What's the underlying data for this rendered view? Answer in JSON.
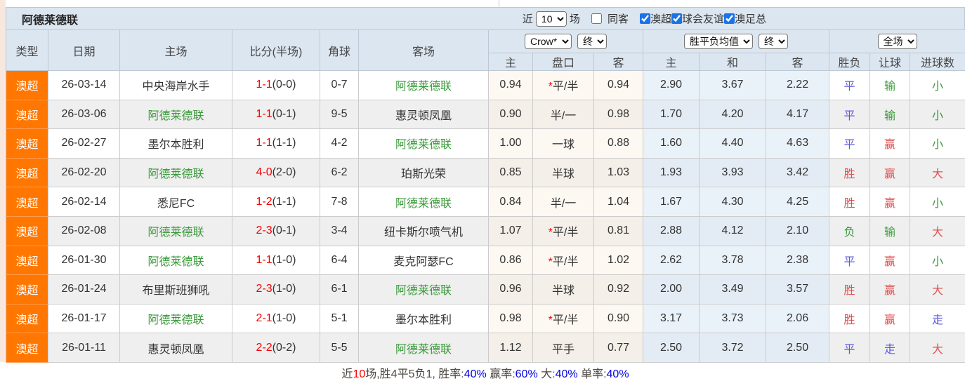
{
  "title": "阿德莱德联",
  "filter_bar": {
    "recent_label": "近",
    "recent_value": "10",
    "matches_label": "场",
    "same_venue_label": "同客",
    "same_venue_checked": false,
    "leagues": [
      {
        "label": "澳超",
        "checked": true
      },
      {
        "label": "球会友谊",
        "checked": true
      },
      {
        "label": "澳足总",
        "checked": true
      }
    ]
  },
  "selectors": {
    "bookmaker": "Crow*",
    "bookmaker_time": "终",
    "avg": "胜平负均值",
    "avg_time": "终",
    "scope": "全场"
  },
  "table": {
    "headers": {
      "type": "类型",
      "date": "日期",
      "home": "主场",
      "score": "比分(半场)",
      "corner": "角球",
      "away": "客场",
      "odds_home": "主",
      "odds_line": "盘口",
      "odds_away": "客",
      "avg_home": "主",
      "avg_draw": "和",
      "avg_away": "客",
      "result": "胜负",
      "handicap": "让球",
      "goals": "进球数"
    },
    "rows": [
      {
        "league": "澳超",
        "date": "26-03-14",
        "home": "中央海岸水手",
        "home_hl": false,
        "score": "1-1",
        "half": "(0-0)",
        "corners": "0-7",
        "away": "阿德莱德联",
        "away_hl": true,
        "oh": "0.94",
        "line": "平/半",
        "star": true,
        "oa": "0.94",
        "ah": "2.90",
        "ad": "3.67",
        "aa": "2.22",
        "result": "平",
        "result_c": "blue",
        "hres": "输",
        "hres_c": "green",
        "goals": "小",
        "goals_c": "green"
      },
      {
        "league": "澳超",
        "date": "26-03-06",
        "home": "阿德莱德联",
        "home_hl": true,
        "score": "1-1",
        "half": "(0-1)",
        "corners": "9-5",
        "away": "惠灵顿凤凰",
        "away_hl": false,
        "oh": "0.90",
        "line": "半/一",
        "star": false,
        "oa": "0.98",
        "ah": "1.70",
        "ad": "4.20",
        "aa": "4.17",
        "result": "平",
        "result_c": "blue",
        "hres": "输",
        "hres_c": "green",
        "goals": "小",
        "goals_c": "green"
      },
      {
        "league": "澳超",
        "date": "26-02-27",
        "home": "墨尔本胜利",
        "home_hl": false,
        "score": "1-1",
        "half": "(1-1)",
        "corners": "4-2",
        "away": "阿德莱德联",
        "away_hl": true,
        "oh": "1.00",
        "line": "一球",
        "star": false,
        "oa": "0.88",
        "ah": "1.60",
        "ad": "4.40",
        "aa": "4.63",
        "result": "平",
        "result_c": "blue",
        "hres": "赢",
        "hres_c": "red",
        "goals": "小",
        "goals_c": "green"
      },
      {
        "league": "澳超",
        "date": "26-02-20",
        "home": "阿德莱德联",
        "home_hl": true,
        "score": "4-0",
        "half": "(2-0)",
        "corners": "6-2",
        "away": "珀斯光荣",
        "away_hl": false,
        "oh": "0.85",
        "line": "半球",
        "star": false,
        "oa": "1.03",
        "ah": "1.93",
        "ad": "3.93",
        "aa": "3.42",
        "result": "胜",
        "result_c": "red",
        "hres": "赢",
        "hres_c": "red",
        "goals": "大",
        "goals_c": "red"
      },
      {
        "league": "澳超",
        "date": "26-02-14",
        "home": "悉尼FC",
        "home_hl": false,
        "score": "1-2",
        "half": "(1-1)",
        "corners": "7-8",
        "away": "阿德莱德联",
        "away_hl": true,
        "oh": "0.84",
        "line": "半/一",
        "star": false,
        "oa": "1.04",
        "ah": "1.67",
        "ad": "4.30",
        "aa": "4.25",
        "result": "胜",
        "result_c": "red",
        "hres": "赢",
        "hres_c": "red",
        "goals": "小",
        "goals_c": "green"
      },
      {
        "league": "澳超",
        "date": "26-02-08",
        "home": "阿德莱德联",
        "home_hl": true,
        "score": "2-3",
        "half": "(0-1)",
        "corners": "3-4",
        "away": "纽卡斯尔喷气机",
        "away_hl": false,
        "oh": "1.07",
        "line": "平/半",
        "star": true,
        "oa": "0.81",
        "ah": "2.88",
        "ad": "4.12",
        "aa": "2.10",
        "result": "负",
        "result_c": "green",
        "hres": "输",
        "hres_c": "green",
        "goals": "大",
        "goals_c": "red"
      },
      {
        "league": "澳超",
        "date": "26-01-30",
        "home": "阿德莱德联",
        "home_hl": true,
        "score": "1-1",
        "half": "(1-0)",
        "corners": "6-4",
        "away": "麦克阿瑟FC",
        "away_hl": false,
        "oh": "0.86",
        "line": "平/半",
        "star": true,
        "oa": "1.02",
        "ah": "2.62",
        "ad": "3.78",
        "aa": "2.38",
        "result": "平",
        "result_c": "blue",
        "hres": "赢",
        "hres_c": "red",
        "goals": "小",
        "goals_c": "green"
      },
      {
        "league": "澳超",
        "date": "26-01-24",
        "home": "布里斯班狮吼",
        "home_hl": false,
        "score": "2-3",
        "half": "(1-0)",
        "corners": "6-1",
        "away": "阿德莱德联",
        "away_hl": true,
        "oh": "0.96",
        "line": "半球",
        "star": false,
        "oa": "0.92",
        "ah": "2.00",
        "ad": "3.49",
        "aa": "3.57",
        "result": "胜",
        "result_c": "red",
        "hres": "赢",
        "hres_c": "red",
        "goals": "大",
        "goals_c": "red"
      },
      {
        "league": "澳超",
        "date": "26-01-17",
        "home": "阿德莱德联",
        "home_hl": true,
        "score": "2-1",
        "half": "(1-0)",
        "corners": "5-1",
        "away": "墨尔本胜利",
        "away_hl": false,
        "oh": "0.98",
        "line": "平/半",
        "star": true,
        "oa": "0.90",
        "ah": "3.17",
        "ad": "3.73",
        "aa": "2.06",
        "result": "胜",
        "result_c": "red",
        "hres": "赢",
        "hres_c": "red",
        "goals": "走",
        "goals_c": "blue"
      },
      {
        "league": "澳超",
        "date": "26-01-11",
        "home": "惠灵顿凤凰",
        "home_hl": false,
        "score": "2-2",
        "half": "(0-2)",
        "corners": "5-5",
        "away": "阿德莱德联",
        "away_hl": true,
        "oh": "1.12",
        "line": "平手",
        "star": false,
        "oa": "0.77",
        "ah": "2.50",
        "ad": "3.72",
        "aa": "2.50",
        "result": "平",
        "result_c": "blue",
        "hres": "走",
        "hres_c": "blue",
        "goals": "大",
        "goals_c": "red"
      }
    ]
  },
  "footer": {
    "segments": [
      {
        "text": "近",
        "c": "dark"
      },
      {
        "text": "10",
        "c": "red"
      },
      {
        "text": "场,胜4平5负1, 胜率:",
        "c": "dark"
      },
      {
        "text": "40%",
        "c": "blue"
      },
      {
        "text": " 赢率:",
        "c": "dark"
      },
      {
        "text": "60%",
        "c": "blue"
      },
      {
        "text": " 大:",
        "c": "dark"
      },
      {
        "text": "40%",
        "c": "blue"
      },
      {
        "text": " 单率:",
        "c": "dark"
      },
      {
        "text": "40%",
        "c": "blue"
      }
    ]
  }
}
